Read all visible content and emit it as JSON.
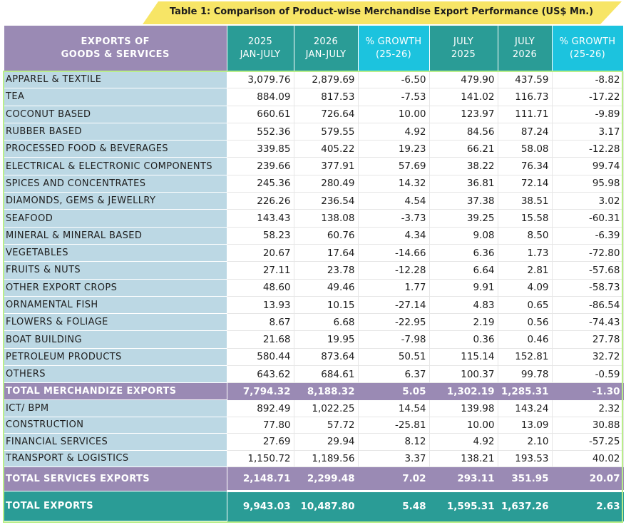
{
  "title": "Table 1: Comparison of Product-wise Merchandise Export Performance (US$ Mn.)",
  "colors": {
    "banner": "#f7e566",
    "header_label": "#9a8ab4",
    "header_teal": "#2a9c96",
    "header_cyan": "#1cc3de",
    "row_label": "#bcd8e4",
    "frame": "#b9ee8a"
  },
  "headers": {
    "label": [
      "EXPORTS OF",
      "GOODS & SERVICES"
    ],
    "c1": [
      "2025",
      "JAN-JULY"
    ],
    "c2": [
      "2026",
      "JAN-JULY"
    ],
    "c3": [
      "% GROWTH",
      "(25-26)"
    ],
    "c4": [
      "JULY",
      "2025"
    ],
    "c5": [
      "JULY",
      "2026"
    ],
    "c6": [
      "% GROWTH",
      "(25-26)"
    ]
  },
  "goods": [
    [
      "APPAREL & TEXTILE",
      "3,079.76",
      "2,879.69",
      "-6.50",
      "479.90",
      "437.59",
      "-8.82"
    ],
    [
      "TEA",
      "884.09",
      "817.53",
      "-7.53",
      "141.02",
      "116.73",
      "-17.22"
    ],
    [
      "COCONUT BASED",
      "660.61",
      "726.64",
      "10.00",
      "123.97",
      "111.71",
      "-9.89"
    ],
    [
      "RUBBER BASED",
      "552.36",
      "579.55",
      "4.92",
      "84.56",
      "87.24",
      "3.17"
    ],
    [
      "PROCESSED FOOD & BEVERAGES",
      "339.85",
      "405.22",
      "19.23",
      "66.21",
      "58.08",
      "-12.28"
    ],
    [
      "ELECTRICAL & ELECTRONIC   COMPONENTS",
      "239.66",
      "377.91",
      "57.69",
      "38.22",
      "76.34",
      "99.74"
    ],
    [
      "SPICES AND CONCENTRATES",
      "245.36",
      "280.49",
      "14.32",
      "36.81",
      "72.14",
      "95.98"
    ],
    [
      "DIAMONDS, GEMS & JEWELLRY",
      "226.26",
      "236.54",
      "4.54",
      "37.38",
      "38.51",
      "3.02"
    ],
    [
      "SEAFOOD",
      "143.43",
      "138.08",
      "-3.73",
      "39.25",
      "15.58",
      "-60.31"
    ],
    [
      "MINERAL & MINERAL BASED",
      "58.23",
      "60.76",
      "4.34",
      "9.08",
      "8.50",
      "-6.39"
    ],
    [
      "VEGETABLES",
      "20.67",
      "17.64",
      "-14.66",
      "6.36",
      "1.73",
      "-72.80"
    ],
    [
      "FRUITS & NUTS",
      "27.11",
      "23.78",
      "-12.28",
      "6.64",
      "2.81",
      "-57.68"
    ],
    [
      "OTHER EXPORT CROPS",
      "48.60",
      "49.46",
      "1.77",
      "9.91",
      "4.09",
      "-58.73"
    ],
    [
      "ORNAMENTAL FISH",
      "13.93",
      "10.15",
      "-27.14",
      "4.83",
      "0.65",
      "-86.54"
    ],
    [
      "FLOWERS & FOLIAGE",
      "8.67",
      "6.68",
      "-22.95",
      "2.19",
      "0.56",
      "-74.43"
    ],
    [
      "BOAT BUILDING",
      "21.68",
      "19.95",
      "-7.98",
      "0.36",
      "0.46",
      "27.78"
    ],
    [
      "PETROLEUM PRODUCTS",
      "580.44",
      "873.64",
      "50.51",
      "115.14",
      "152.81",
      "32.72"
    ],
    [
      "OTHERS",
      "643.62",
      "684.61",
      "6.37",
      "100.37",
      "99.78",
      "-0.59"
    ]
  ],
  "total_merchandise": [
    "TOTAL MERCHANDIZE EXPORTS",
    "7,794.32",
    "8,188.32",
    "5.05",
    "1,302.19",
    "1,285.31",
    "-1.30"
  ],
  "services": [
    [
      "ICT/ BPM",
      "892.49",
      "1,022.25",
      "14.54",
      "139.98",
      "143.24",
      "2.32"
    ],
    [
      "CONSTRUCTION",
      "77.80",
      "57.72",
      "-25.81",
      "10.00",
      "13.09",
      "30.88"
    ],
    [
      "FINANCIAL  SERVICES",
      "27.69",
      "29.94",
      "8.12",
      "4.92",
      "2.10",
      "-57.25"
    ],
    [
      "TRANSPORT  & LOGISTICS",
      "1,150.72",
      "1,189.56",
      "3.37",
      "138.21",
      "193.53",
      "40.02"
    ]
  ],
  "total_services": [
    "TOTAL SERVICES EXPORTS",
    "2,148.71",
    "2,299.48",
    "7.02",
    "293.11",
    "351.95",
    "20.07"
  ],
  "total_exports": [
    "TOTAL EXPORTS",
    "9,943.03",
    "10,487.80",
    "5.48",
    "1,595.31",
    "1,637.26",
    "2.63"
  ]
}
